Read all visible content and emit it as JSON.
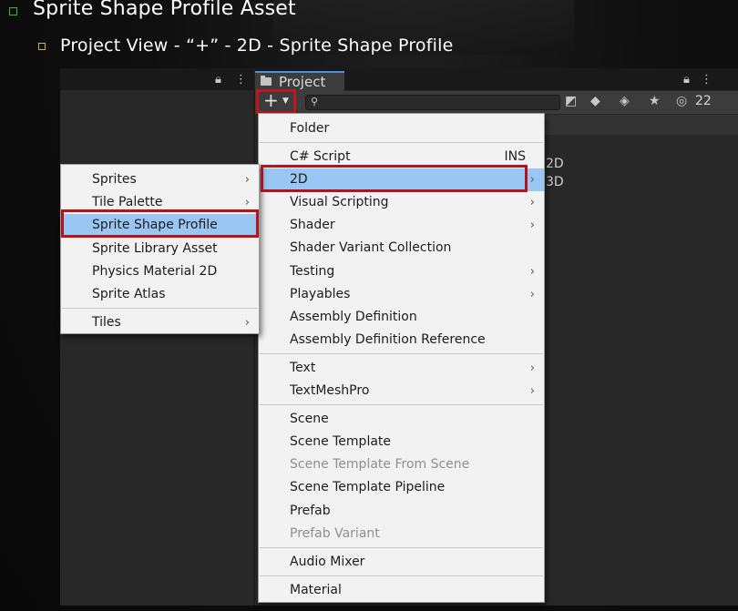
{
  "slide": {
    "title": "Sprite Shape Profile Asset",
    "subtitle": "Project View - “+” - 2D - Sprite Shape Profile",
    "colors": {
      "bullet1": "#2fbf3a",
      "bullet2": "#e0b020",
      "highlight_border": "#b3141b",
      "selection": "#99c6f2"
    }
  },
  "editor": {
    "project_tab_label": "Project",
    "toolbar": {
      "plus_icon": "plus-icon",
      "hidden_count": "22",
      "icons": [
        "search-icon",
        "scene-visibility-icon",
        "filter-by-type-icon",
        "label-icon",
        "favorite-star-icon",
        "hidden-eye-icon"
      ]
    },
    "assets": [
      "2D",
      "3D"
    ]
  },
  "main_menu": {
    "items": [
      {
        "label": "Folder"
      },
      {
        "label": "C# Script",
        "shortcut": "INS"
      },
      {
        "label": "2D",
        "arrow": "›"
      },
      {
        "label": "Visual Scripting",
        "arrow": "›"
      },
      {
        "label": "Shader",
        "arrow": "›"
      },
      {
        "label": "Shader Variant Collection"
      },
      {
        "label": "Testing",
        "arrow": "›"
      },
      {
        "label": "Playables",
        "arrow": "›"
      },
      {
        "label": "Assembly Definition"
      },
      {
        "label": "Assembly Definition Reference"
      },
      {
        "label": "Text",
        "arrow": "›"
      },
      {
        "label": "TextMeshPro",
        "arrow": "›"
      },
      {
        "label": "Scene"
      },
      {
        "label": "Scene Template"
      },
      {
        "label": "Scene Template From Scene"
      },
      {
        "label": "Scene Template Pipeline"
      },
      {
        "label": "Prefab"
      },
      {
        "label": "Prefab Variant"
      },
      {
        "label": "Audio Mixer"
      },
      {
        "label": "Material"
      }
    ]
  },
  "submenu_2d": {
    "items": [
      {
        "label": "Sprites",
        "arrow": "›"
      },
      {
        "label": "Tile Palette",
        "arrow": "›"
      },
      {
        "label": "Sprite Shape Profile"
      },
      {
        "label": "Sprite Library Asset"
      },
      {
        "label": "Physics Material 2D"
      },
      {
        "label": "Sprite Atlas"
      },
      {
        "label": "Tiles",
        "arrow": "›"
      }
    ]
  }
}
